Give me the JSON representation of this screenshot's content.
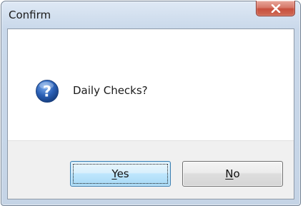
{
  "window": {
    "title": "Confirm"
  },
  "dialog": {
    "icon": "question-icon",
    "message": "Daily Checks?"
  },
  "buttons": {
    "yes": {
      "accel": "Y",
      "rest": "es"
    },
    "no": {
      "accel": "N",
      "rest": "o"
    }
  },
  "colors": {
    "title_bar": "#c9d8ea",
    "close_button": "#c7503e",
    "question_icon": "#2a5fb5",
    "default_button_border": "#3c7fb1"
  }
}
